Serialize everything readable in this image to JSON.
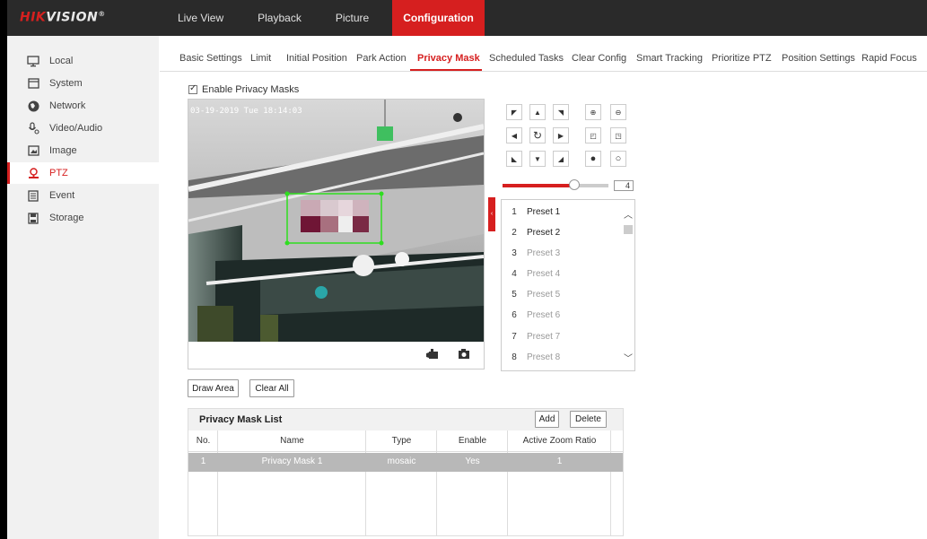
{
  "brand": {
    "hik": "HIK",
    "vision": "VISION",
    "mark": "®"
  },
  "topnav": [
    "Live View",
    "Playback",
    "Picture",
    "Configuration"
  ],
  "sidebar": [
    {
      "label": "Local",
      "icon": "monitor-icon"
    },
    {
      "label": "System",
      "icon": "system-icon"
    },
    {
      "label": "Network",
      "icon": "network-globe-icon"
    },
    {
      "label": "Video/Audio",
      "icon": "microphone-icon"
    },
    {
      "label": "Image",
      "icon": "image-icon"
    },
    {
      "label": "PTZ",
      "icon": "ptz-camera-icon",
      "active": true
    },
    {
      "label": "Event",
      "icon": "event-calendar-icon"
    },
    {
      "label": "Storage",
      "icon": "storage-disk-icon"
    }
  ],
  "subtabs": [
    "Basic Settings",
    "Limit",
    "Initial Position",
    "Park Action",
    "Privacy Mask",
    "Scheduled Tasks",
    "Clear Config",
    "Smart Tracking",
    "Prioritize PTZ",
    "Position Settings",
    "Rapid Focus"
  ],
  "active_subtab": "Privacy Mask",
  "enable_label": "Enable Privacy Masks",
  "enable_checked": true,
  "osd_text": "03-19-2019 Tue 18:14:03",
  "ptz": {
    "speed_value": "4",
    "speed_fraction": 0.68,
    "presets": [
      {
        "no": "1",
        "name": "Preset 1",
        "set": true
      },
      {
        "no": "2",
        "name": "Preset 2",
        "set": true
      },
      {
        "no": "3",
        "name": "Preset 3",
        "set": false
      },
      {
        "no": "4",
        "name": "Preset 4",
        "set": false
      },
      {
        "no": "5",
        "name": "Preset 5",
        "set": false
      },
      {
        "no": "6",
        "name": "Preset 6",
        "set": false
      },
      {
        "no": "7",
        "name": "Preset 7",
        "set": false
      },
      {
        "no": "8",
        "name": "Preset 8",
        "set": false
      }
    ]
  },
  "buttons": {
    "draw_area": "Draw Area",
    "clear_all": "Clear All",
    "add": "Add",
    "delete": "Delete"
  },
  "mask_list": {
    "title": "Privacy Mask List",
    "columns": [
      "No.",
      "Name",
      "Type",
      "Enable",
      "Active Zoom Ratio"
    ],
    "rows": [
      {
        "no": "1",
        "name": "Privacy Mask 1",
        "type": "mosaic",
        "enable": "Yes",
        "ratio": "1"
      }
    ]
  },
  "colors": {
    "accent": "#d61f1f",
    "topbar": "#2a2a2a",
    "sidebar": "#f1f1f1"
  }
}
